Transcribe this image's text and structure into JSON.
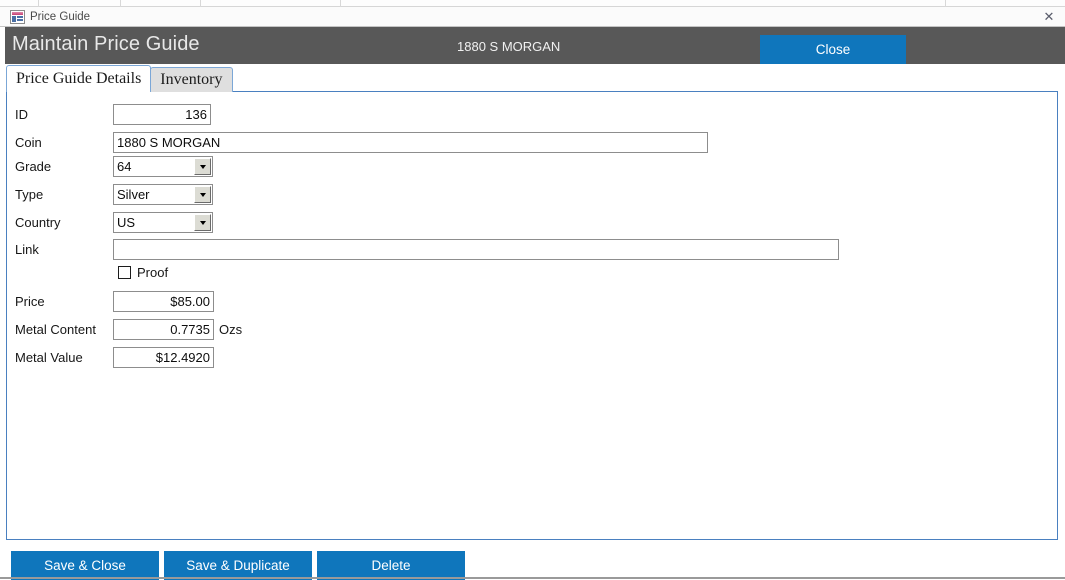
{
  "window": {
    "doc_tab_label": "Price Guide",
    "doc_icon": "access-form-icon",
    "close_glyph": "✕"
  },
  "header": {
    "title": "Maintain Price Guide",
    "subtitle": "1880 S MORGAN",
    "close_label": "Close",
    "bg_color": "#585858",
    "accent_color": "#0f76bc"
  },
  "tabs": [
    {
      "label": "Price Guide Details",
      "active": true
    },
    {
      "label": "Inventory",
      "active": false
    }
  ],
  "form": {
    "fields": [
      {
        "label": "ID",
        "value": "136"
      },
      {
        "label": "Coin",
        "value": "1880 S MORGAN"
      },
      {
        "label": "Grade",
        "value": "64"
      },
      {
        "label": "Type",
        "value": "Silver"
      },
      {
        "label": "Country",
        "value": "US"
      },
      {
        "label": "Link",
        "value": ""
      },
      {
        "label": "Price",
        "value": "$85.00"
      },
      {
        "label": "Metal Content",
        "value": "0.7735"
      },
      {
        "label": "Metal Value",
        "value": "$12.4920"
      }
    ],
    "checkbox": {
      "label": "Proof",
      "checked": false
    },
    "metal_content_unit": "Ozs"
  },
  "footer": {
    "buttons": [
      {
        "label": "Save & Close"
      },
      {
        "label": "Save & Duplicate"
      },
      {
        "label": "Delete"
      }
    ]
  }
}
